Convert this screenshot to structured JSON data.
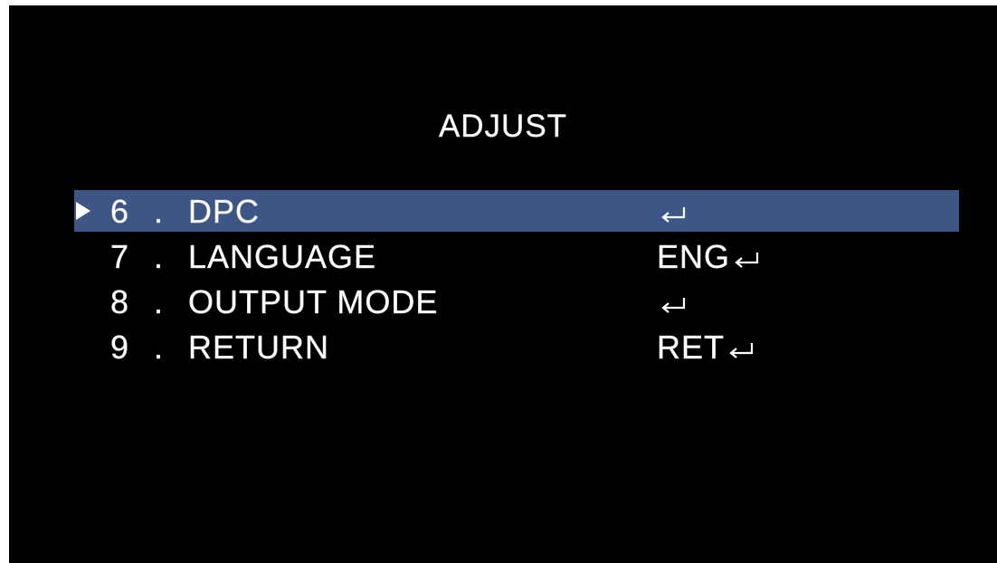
{
  "menu": {
    "title": "ADJUST",
    "items": [
      {
        "number": "6",
        "separator": ".",
        "label": "DPC",
        "value": "",
        "icon": "enter-icon",
        "selected": true
      },
      {
        "number": "7",
        "separator": ".",
        "label": "LANGUAGE",
        "value": "ENG",
        "icon": "enter-icon",
        "selected": false
      },
      {
        "number": "8",
        "separator": ".",
        "label": "OUTPUT MODE",
        "value": "",
        "icon": "enter-icon",
        "selected": false
      },
      {
        "number": "9",
        "separator": ".",
        "label": "RETURN",
        "value": "RET",
        "icon": "enter-icon",
        "selected": false
      }
    ]
  },
  "colors": {
    "background": "#000000",
    "highlight": "#3e5686",
    "text": "#ffffff"
  }
}
